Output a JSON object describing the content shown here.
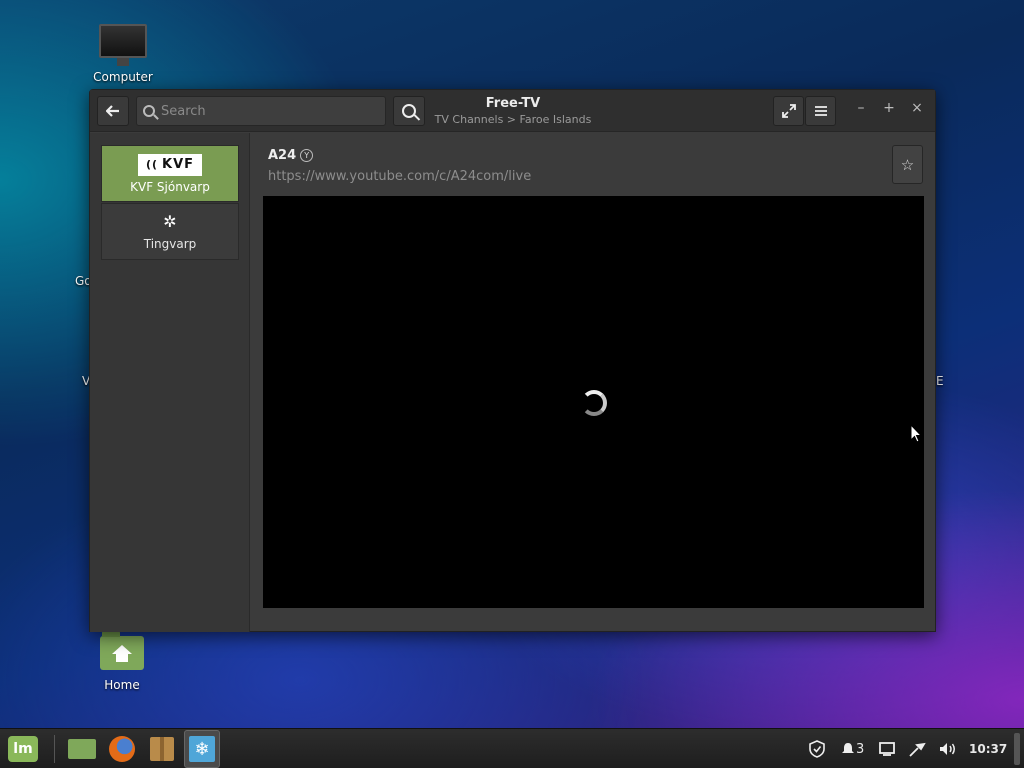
{
  "desktop": {
    "icons": [
      {
        "label": "Computer"
      },
      {
        "label": "Home"
      }
    ],
    "edge_fragments": [
      "Go",
      "V",
      "E"
    ]
  },
  "window": {
    "title": "Free-TV",
    "subtitle": "TV Channels > Faroe Islands",
    "search": {
      "placeholder": "Search",
      "value": ""
    },
    "channels": [
      {
        "logo_text": "KVF",
        "label": "KVF Sjónvarp",
        "selected": true
      },
      {
        "logo_text": "",
        "label": "Tingvarp",
        "selected": false
      }
    ],
    "current_channel": {
      "name": "A24",
      "badge": "Y",
      "url": "https://www.youtube.com/c/A24com/live"
    },
    "controls": {
      "back": "back-arrow-icon",
      "fullscreen": "expand-icon",
      "menu": "hamburger-icon",
      "minimize": "–",
      "maximize": "+",
      "close": "×",
      "favorite": "☆"
    }
  },
  "taskbar": {
    "menu_logo": "lm",
    "apps": [
      "files",
      "firefox",
      "package-manager",
      "free-tv"
    ],
    "tray": {
      "notifications_count": "3",
      "clock": "10:37"
    }
  },
  "colors": {
    "accent": "#7a9c52",
    "window_bg": "#3b3b3b",
    "titlebar_bg": "#2f2f2f"
  }
}
